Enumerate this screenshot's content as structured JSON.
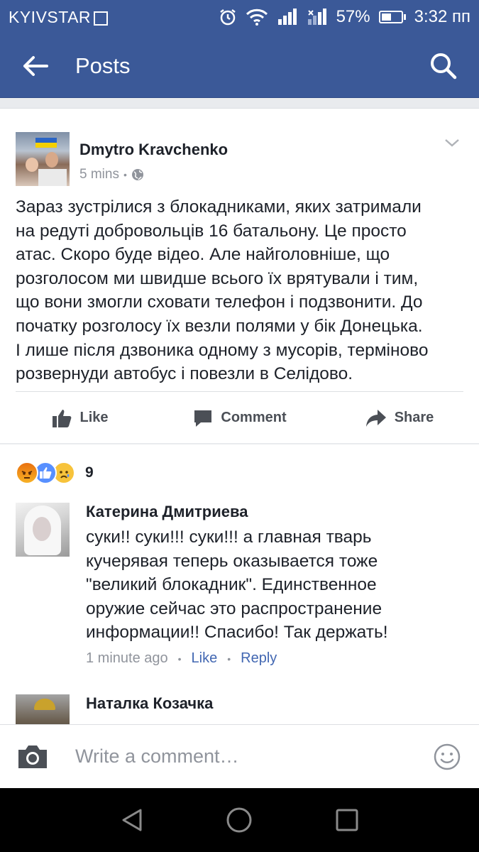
{
  "status_bar": {
    "carrier": "KYIVSTAR",
    "battery": "57%",
    "battery_level": 0.57,
    "time": "3:32 пп"
  },
  "app_bar": {
    "title": "Posts",
    "back_icon": "arrow-left-icon",
    "search_icon": "search-icon"
  },
  "post": {
    "author": "Dmytro Kravchenko",
    "time": "5 mins",
    "separator": "•",
    "privacy_icon": "globe-icon",
    "text": "Зараз зустрілися з блокадниками, яких затримали\nна редуті добровольців 16 батальону. Це просто\nатас. Скоро буде відео. Але найголовніше, що\nрозголосом ми швидше всього їх врятували і тим,\nщо вони змогли сховати телефон і подзвонити. До\nпочатку розголосу їх везли полями у бік Донецька.\nІ лише після дзвоника одному з мусорів, терміново\nрозвернуди автобус і повезли в Селідово.",
    "actions": {
      "like": "Like",
      "comment": "Comment",
      "share": "Share"
    }
  },
  "reactions": {
    "types": [
      "angry",
      "like",
      "sad"
    ],
    "count": "9"
  },
  "comments": [
    {
      "name": "Катерина Дмитриева",
      "text": "суки!! суки!!! суки!!! а главная тварь\nкучерявая теперь  оказывается тоже\n\"великий блокадник\". Единственное\nоружие сейчас это  распространение\nинформации!! Спасибо! Так держать!",
      "time": "1 minute ago",
      "like": "Like",
      "reply": "Reply",
      "separator": "•"
    },
    {
      "name": "Наталка Козачка"
    }
  ],
  "composer": {
    "placeholder": "Write a comment…",
    "camera_icon": "camera-icon",
    "emoji_icon": "smiley-icon"
  },
  "colors": {
    "brand": "#3b5998",
    "link": "#4267b2",
    "meta_text": "#90949c",
    "background": "#e9ebee"
  }
}
